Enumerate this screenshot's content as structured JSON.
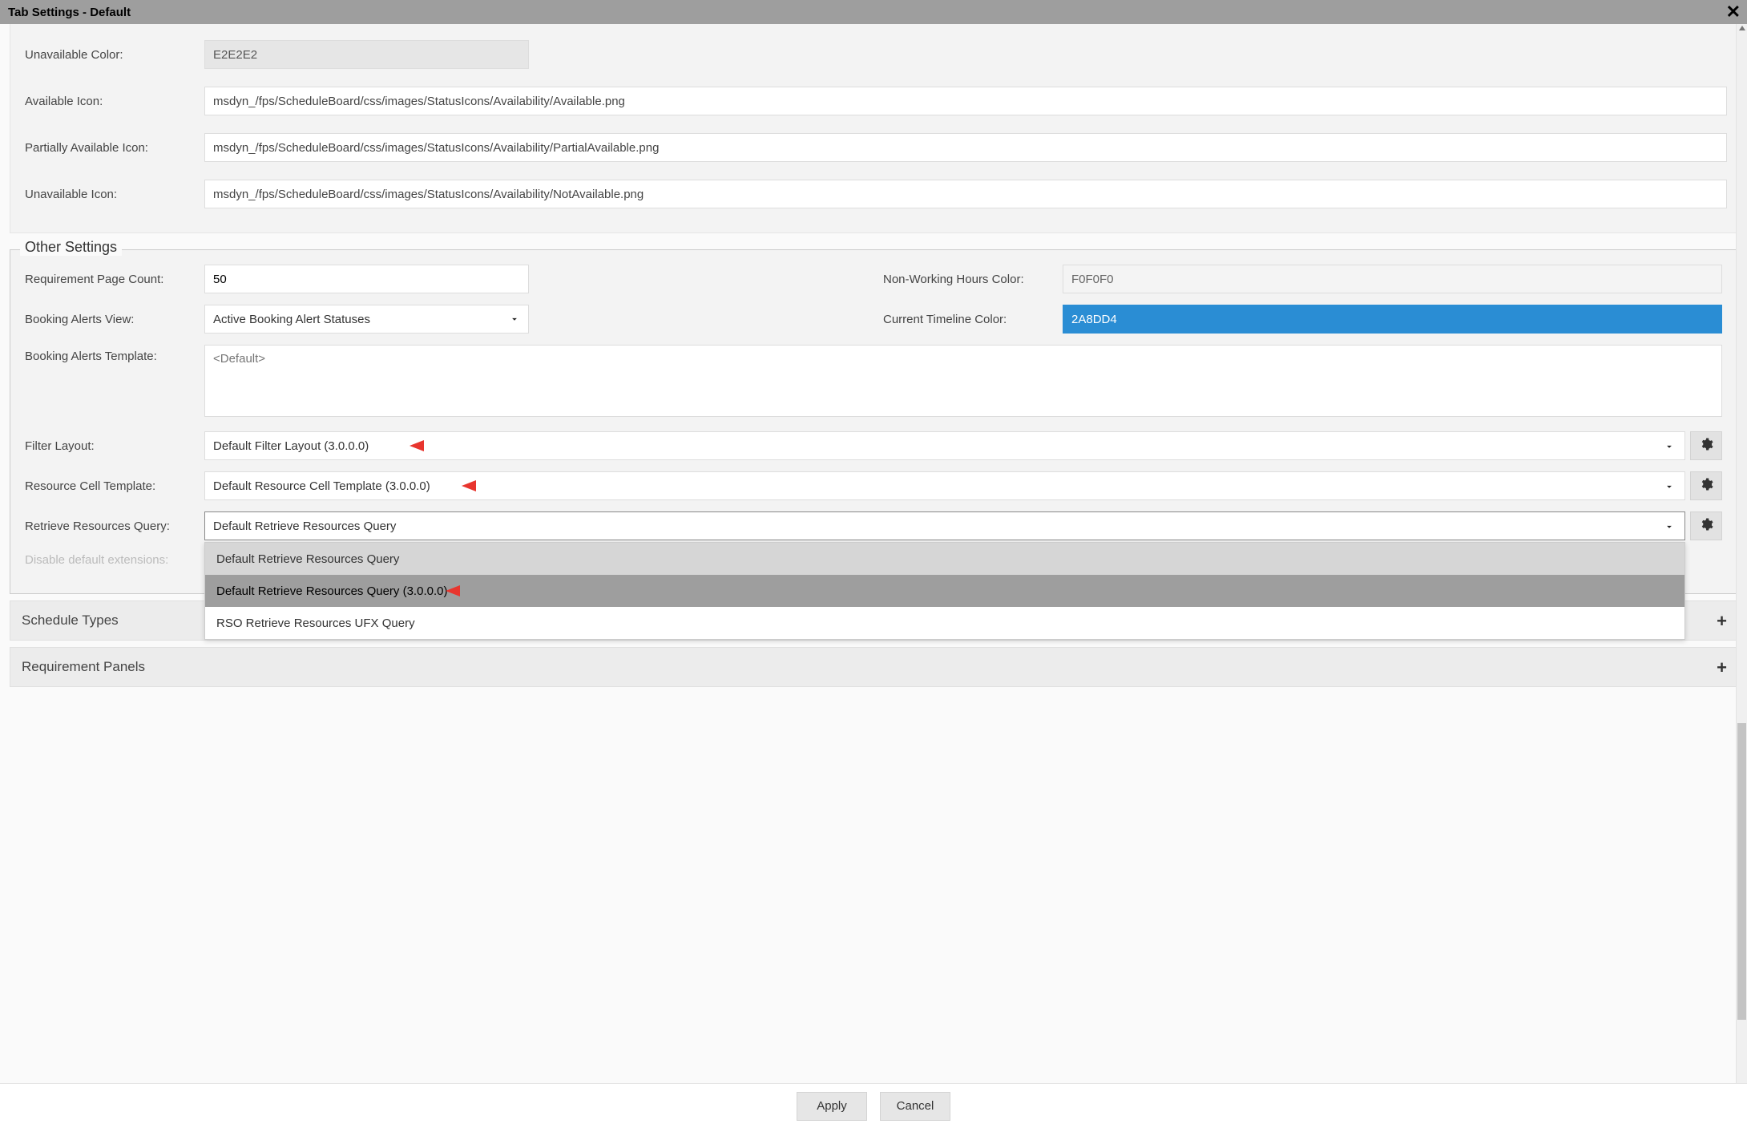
{
  "title": "Tab Settings - Default",
  "top": {
    "unavailable_color_label": "Unavailable Color:",
    "unavailable_color_value": "E2E2E2",
    "available_icon_label": "Available Icon:",
    "available_icon_value": "msdyn_/fps/ScheduleBoard/css/images/StatusIcons/Availability/Available.png",
    "partial_icon_label": "Partially Available Icon:",
    "partial_icon_value": "msdyn_/fps/ScheduleBoard/css/images/StatusIcons/Availability/PartialAvailable.png",
    "unavailable_icon_label": "Unavailable Icon:",
    "unavailable_icon_value": "msdyn_/fps/ScheduleBoard/css/images/StatusIcons/Availability/NotAvailable.png"
  },
  "other": {
    "legend": "Other Settings",
    "req_page_count_label": "Requirement Page Count:",
    "req_page_count_value": "50",
    "nonworking_color_label": "Non-Working Hours Color:",
    "nonworking_color_value": "F0F0F0",
    "booking_alerts_view_label": "Booking Alerts View:",
    "booking_alerts_view_value": "Active Booking Alert Statuses",
    "timeline_color_label": "Current Timeline Color:",
    "timeline_color_value": "2A8DD4",
    "booking_alerts_tpl_label": "Booking Alerts Template:",
    "booking_alerts_tpl_placeholder": "<Default>",
    "filter_layout_label": "Filter Layout:",
    "filter_layout_value": "Default Filter Layout (3.0.0.0)",
    "resource_cell_label": "Resource Cell Template:",
    "resource_cell_value": "Default Resource Cell Template (3.0.0.0)",
    "retrieve_query_label": "Retrieve Resources Query:",
    "retrieve_query_value": "Default Retrieve Resources Query",
    "retrieve_query_options": [
      "Default Retrieve Resources Query",
      "Default Retrieve Resources Query (3.0.0.0)",
      "RSO Retrieve Resources UFX Query"
    ],
    "disable_ext_label": "Disable default extensions:"
  },
  "sections": {
    "schedule_types": "Schedule Types",
    "requirement_panels": "Requirement Panels"
  },
  "footer": {
    "apply": "Apply",
    "cancel": "Cancel"
  }
}
